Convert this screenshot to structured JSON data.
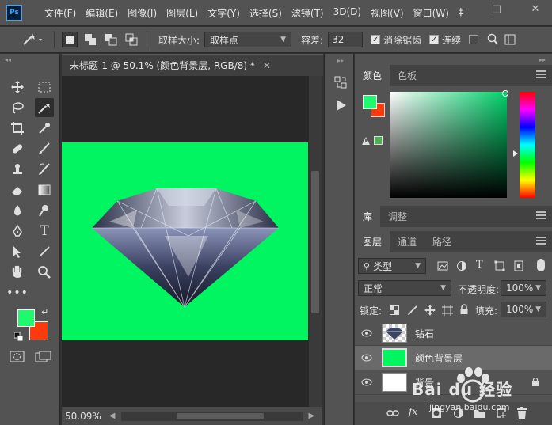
{
  "menubar": {
    "logo": "Ps",
    "items": [
      "文件(F)",
      "编辑(E)",
      "图像(I)",
      "图层(L)",
      "文字(Y)",
      "选择(S)",
      "滤镜(T)",
      "3D(D)",
      "视图(V)",
      "窗口(W)",
      "‡"
    ],
    "minimize": "—",
    "maximize": "□",
    "close": "✕"
  },
  "options": {
    "sample_size_label": "取样大小:",
    "sample_size_value": "取样点",
    "tolerance_label": "容差:",
    "tolerance_value": "32",
    "antialias_label": "消除锯齿",
    "antialias_checked": true,
    "contiguous_label": "连续",
    "contiguous_checked": true,
    "sample_all_checked": false
  },
  "document": {
    "tab_title": "未标题-1 @ 50.1% (颜色背景层, RGB/8) *",
    "zoom": "50.09%",
    "canvas_color": "#00f560"
  },
  "colors": {
    "foreground": "#1ff96d",
    "background": "#fd3a0e"
  },
  "color_panel": {
    "tabs": [
      "颜色",
      "色板"
    ]
  },
  "library_panel": {
    "tabs": [
      "库",
      "调整"
    ]
  },
  "layers_panel": {
    "tabs": [
      "图层",
      "通道",
      "路径"
    ],
    "filter_kind": "类型",
    "blend_mode": "正常",
    "opacity_label": "不透明度:",
    "opacity_value": "100%",
    "lock_label": "锁定:",
    "fill_label": "填充:",
    "fill_value": "100%",
    "layers": [
      {
        "name": "钻石",
        "thumb": "diamond",
        "selected": false
      },
      {
        "name": "颜色背景层",
        "thumb": "#00f560",
        "selected": true
      },
      {
        "name": "背景",
        "thumb": "#ffffff",
        "selected": false
      }
    ]
  },
  "watermark": {
    "brand": "Bai du 经验",
    "url": "jingyan.baidu.com"
  }
}
